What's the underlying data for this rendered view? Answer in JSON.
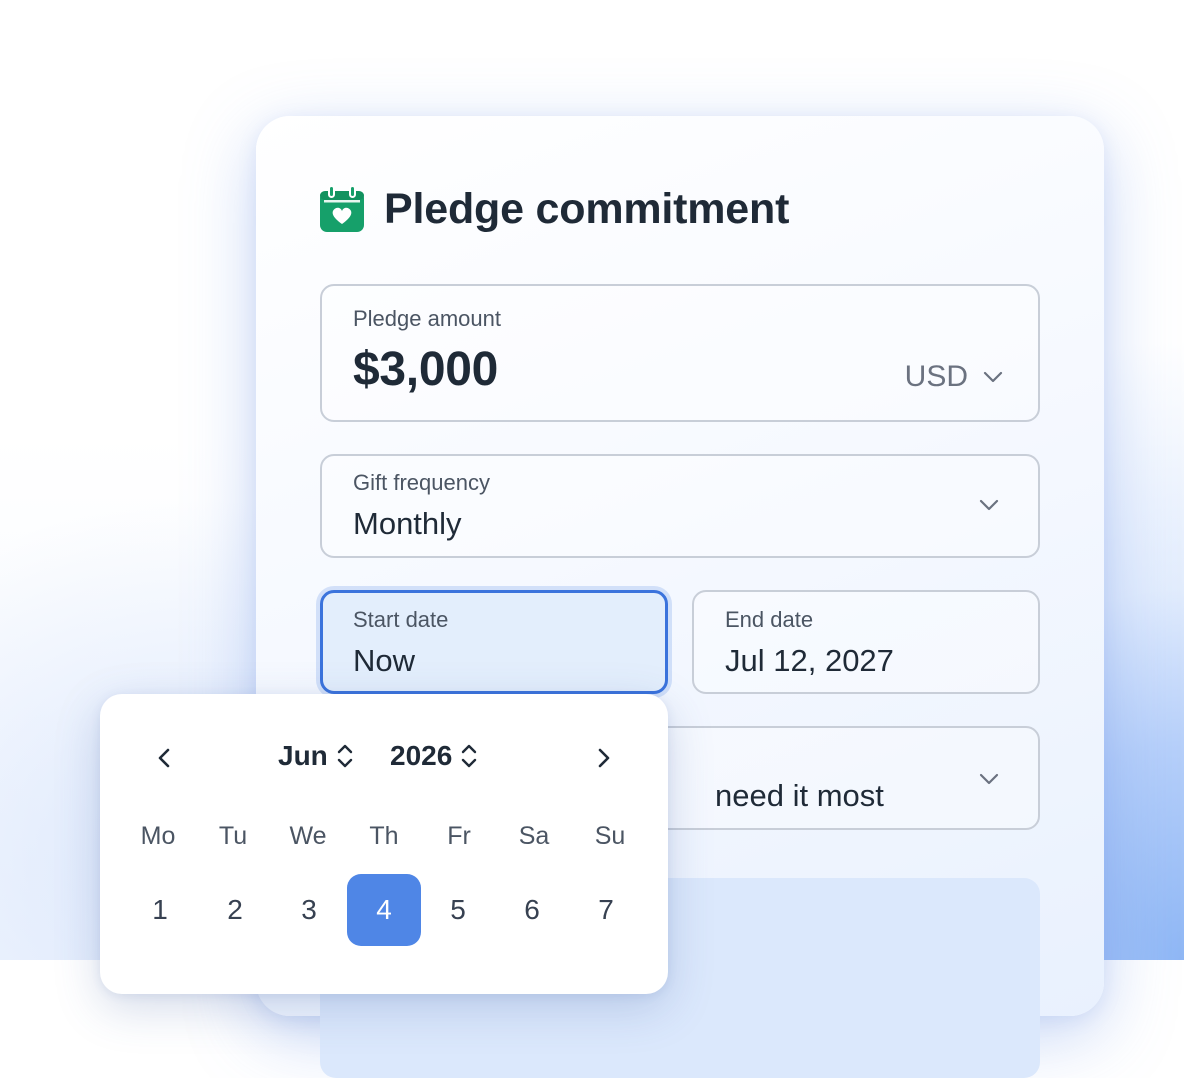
{
  "title": "Pledge commitment",
  "icon": "calendar-heart-icon",
  "colors": {
    "accent": "#3b73dc",
    "selected_day": "#4f86e6",
    "icon_green": "#16a06a"
  },
  "fields": {
    "amount": {
      "label": "Pledge amount",
      "value": "$3,000",
      "currency": "USD"
    },
    "frequency": {
      "label": "Gift frequency",
      "value": "Monthly"
    },
    "start_date": {
      "label": "Start date",
      "value": "Now"
    },
    "end_date": {
      "label": "End date",
      "value": "Jul 12, 2027"
    },
    "fund": {
      "value_visible": "need it most"
    }
  },
  "calendar": {
    "month": "Jun",
    "year": "2026",
    "weekdays": [
      "Mo",
      "Tu",
      "We",
      "Th",
      "Fr",
      "Sa",
      "Su"
    ],
    "first_week": [
      "1",
      "2",
      "3",
      "4",
      "5",
      "6",
      "7"
    ],
    "selected_day": "4"
  }
}
